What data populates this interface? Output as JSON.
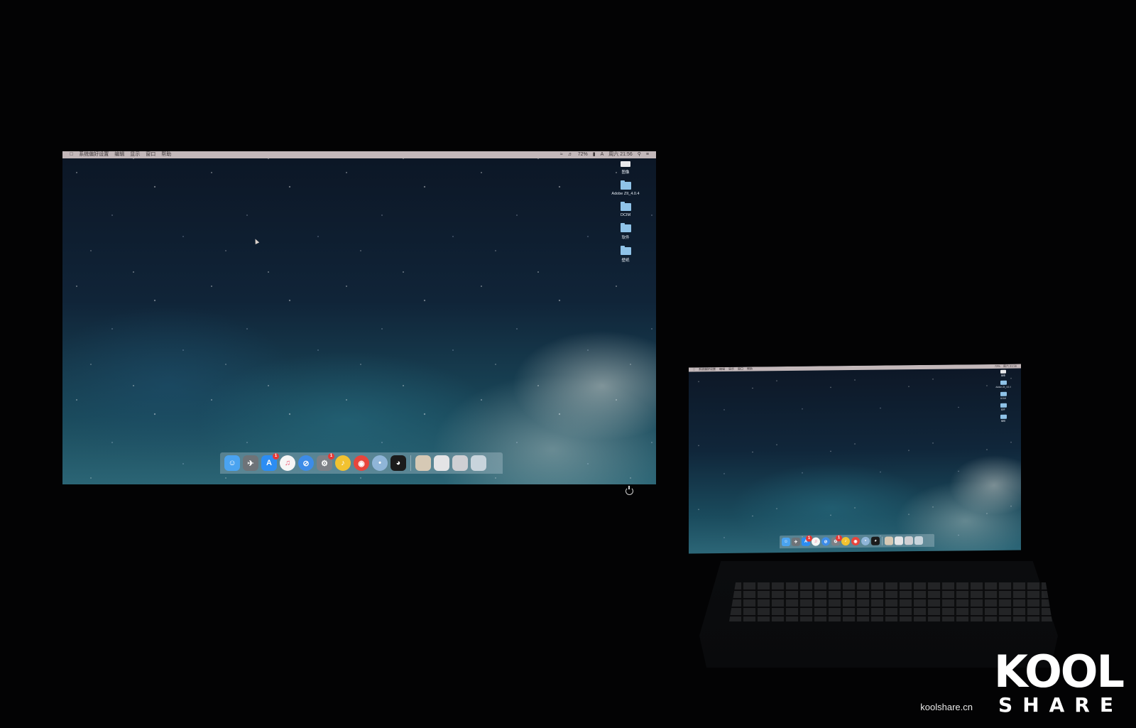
{
  "menubar": {
    "apple": "",
    "items": [
      "系统偏好设置",
      "编辑",
      "显示",
      "窗口",
      "帮助"
    ],
    "status": {
      "battery": "72%",
      "input": "A",
      "clock": "周六 21:56"
    }
  },
  "desktop_icons": [
    {
      "label": "图像",
      "kind": "drive-icon"
    },
    {
      "label": "Adobe ZII_4.0.4",
      "kind": "folder-icon"
    },
    {
      "label": "DCIM",
      "kind": "folder-icon"
    },
    {
      "label": "软件",
      "kind": "folder-icon"
    },
    {
      "label": "壁纸",
      "kind": "folder-icon"
    }
  ],
  "dock": {
    "apps": [
      {
        "name": "finder-icon",
        "color": "#4aa3f0",
        "glyph": "☺"
      },
      {
        "name": "launchpad-icon",
        "color": "#6e7378",
        "glyph": "✈"
      },
      {
        "name": "app-store-icon",
        "color": "#2c8df3",
        "glyph": "A",
        "badge": "1"
      },
      {
        "name": "itunes-icon",
        "color": "#f6f6f6",
        "glyph": "♫"
      },
      {
        "name": "safari-icon",
        "color": "#3d8ce8",
        "glyph": "⊘"
      },
      {
        "name": "system-preferences-icon",
        "color": "#7d8086",
        "glyph": "⚙",
        "badge": "1"
      },
      {
        "name": "qq-music-icon",
        "color": "#f2c230",
        "glyph": "♪"
      },
      {
        "name": "chrome-icon",
        "color": "#e8453c",
        "glyph": "◉"
      },
      {
        "name": "app-icon",
        "color": "#8fb5d8",
        "glyph": "•"
      },
      {
        "name": "qq-icon",
        "color": "#1b1b1b",
        "glyph": "◕"
      }
    ],
    "docs": [
      {
        "name": "preview-doc-icon",
        "color": "#d6c9b5"
      },
      {
        "name": "document-stack-icon",
        "color": "#e4e4e6"
      },
      {
        "name": "downloads-stack-icon",
        "color": "#cfcfd3"
      },
      {
        "name": "trash-icon",
        "color": "#c8d4dc"
      }
    ]
  },
  "watermark": {
    "url": "koolshare.cn",
    "logo": "KOOL",
    "sub": "SHARE"
  }
}
